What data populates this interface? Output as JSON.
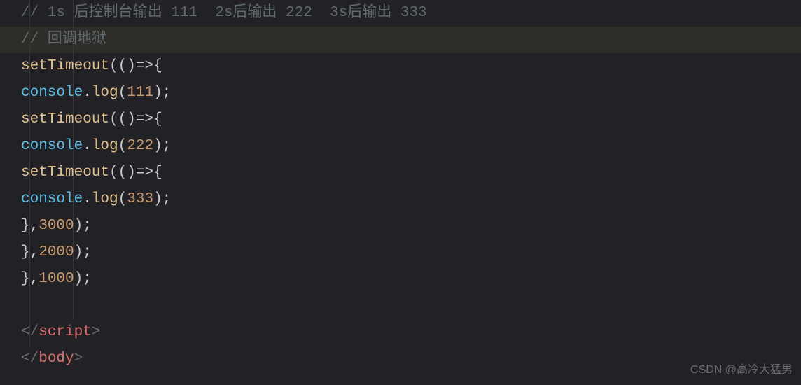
{
  "code": {
    "comment1": "// 1s 后控制台输出 111  2s后输出 222  3s后输出 333",
    "comment2": "// 回调地狱",
    "setTimeout": "setTimeout",
    "console": "console",
    "log": "log",
    "arrow": "=>",
    "val1": "111",
    "val2": "222",
    "val3": "333",
    "delay1": "1000",
    "delay2": "2000",
    "delay3": "3000",
    "lparen": "(",
    "rparen": ")",
    "lbrace": "{",
    "rbrace": "}",
    "dot": ".",
    "comma": ",",
    "semi": ";",
    "closeScript_open": "</",
    "closeScript_name": "script",
    "closeScript_end": ">",
    "closeBody_open": "</",
    "closeBody_name": "body",
    "closeBody_end": ">"
  },
  "watermark": "CSDN @高冷大猛男"
}
